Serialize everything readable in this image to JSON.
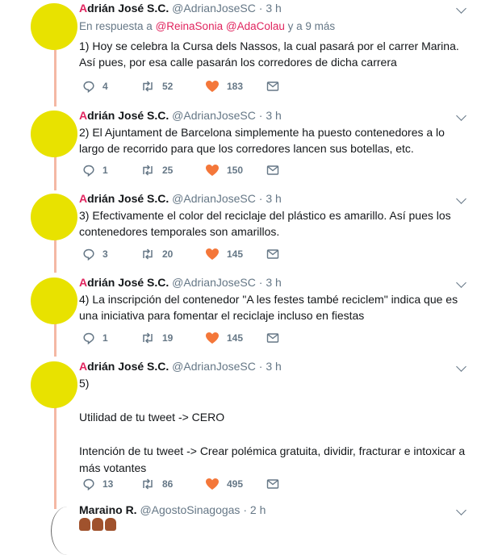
{
  "colors": {
    "accent": "#e0245e",
    "avatar": "#e8e200",
    "thread_line": "#f4b8a4",
    "muted": "#657786"
  },
  "tweets": [
    {
      "name_first": "A",
      "name_rest": "drián José S.C.",
      "handle": "@AdrianJoseSC",
      "dot": "·",
      "time": "3 h",
      "reply": {
        "prefix": "En respuesta a",
        "mention1": "@ReinaSonia",
        "mention2": "@AdaColau",
        "suffix": "y a 9 más"
      },
      "text": "1) Hoy se celebra la Cursa dels Nassos, la cual pasará por el carrer Marina. Así pues, por esa calle pasarán los corredores de dicha carrera",
      "replies": "4",
      "retweets": "52",
      "likes": "183"
    },
    {
      "name_first": "A",
      "name_rest": "drián José S.C.",
      "handle": "@AdrianJoseSC",
      "dot": "·",
      "time": "3 h",
      "text": "2) El Ajuntament de Barcelona simplemente ha puesto contenedores a lo largo de recorrido para que los corredores lancen sus botellas, etc.",
      "replies": "1",
      "retweets": "25",
      "likes": "150"
    },
    {
      "name_first": "A",
      "name_rest": "drián José S.C.",
      "handle": "@AdrianJoseSC",
      "dot": "·",
      "time": "3 h",
      "text": "3) Efectivamente el color del reciclaje del plástico es amarillo. Así pues los contenedores temporales son amarillos.",
      "replies": "3",
      "retweets": "20",
      "likes": "145"
    },
    {
      "name_first": "A",
      "name_rest": "drián José S.C.",
      "handle": "@AdrianJoseSC",
      "dot": "·",
      "time": "3 h",
      "text": "4) La inscripción del contenedor \"A les festes també reciclem\" indica que es una iniciativa para fomentar el reciclaje incluso en fiestas",
      "replies": "1",
      "retweets": "19",
      "likes": "145"
    },
    {
      "name_first": "A",
      "name_rest": "drián José S.C.",
      "handle": "@AdrianJoseSC",
      "dot": "·",
      "time": "3 h",
      "text": "5)\n\nUtilidad de tu tweet -> CERO\n\nIntención de tu tweet -> Crear polémica gratuita, dividir, fracturar e intoxicar a más votantes",
      "replies": "13",
      "retweets": "86",
      "likes": "495"
    },
    {
      "name_first": "",
      "name_rest": "Maraino R.",
      "handle": "@AgostoSinagogas",
      "dot": "·",
      "time": "2 h"
    }
  ]
}
